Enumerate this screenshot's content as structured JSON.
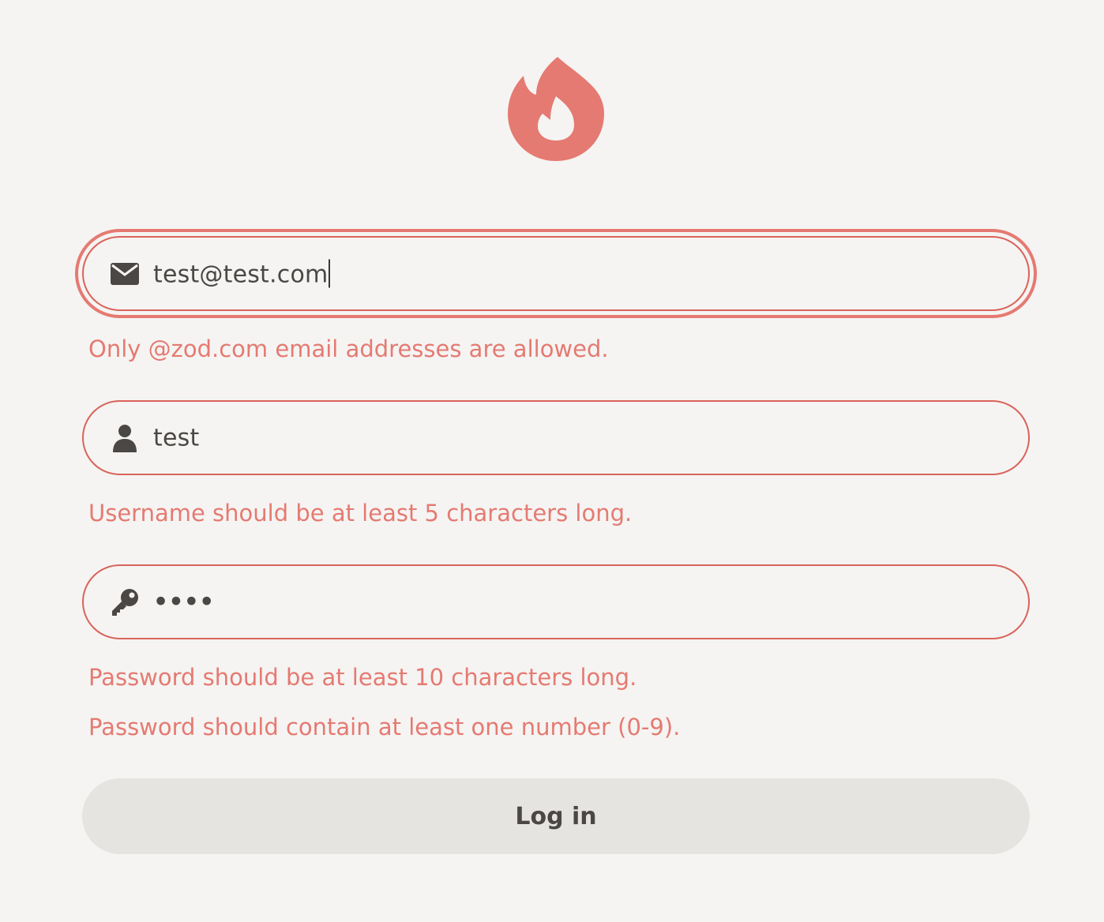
{
  "logo": {
    "icon": "flame-icon",
    "color": "#e57a72"
  },
  "form": {
    "email": {
      "icon": "envelope-icon",
      "value": "test@test.com",
      "error": "Only @zod.com email addresses are allowed."
    },
    "username": {
      "icon": "user-icon",
      "value": "test",
      "error": "Username should be at least 5 characters long."
    },
    "password": {
      "icon": "key-icon",
      "value": "••••",
      "errors": [
        "Password should be at least 10 characters long.",
        "Password should contain at least one number (0-9)."
      ]
    },
    "submit_label": "Log in"
  },
  "colors": {
    "background": "#f5f4f2",
    "error": "#e57a72",
    "border": "#d9635b",
    "text": "#4a4744",
    "button_bg": "#e6e4e1"
  }
}
